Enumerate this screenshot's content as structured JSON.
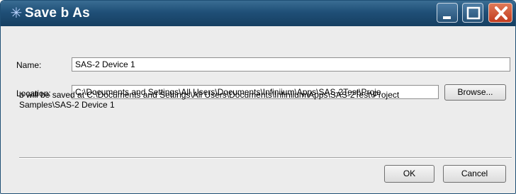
{
  "window": {
    "title": "Save b As",
    "app_icon": "agilent-spark-icon",
    "controls": {
      "minimize_icon": "minimize-icon",
      "maximize_icon": "maximize-icon",
      "close_icon": "close-icon"
    }
  },
  "form": {
    "name_label": "Name:",
    "name_value": "SAS-2 Device 1",
    "location_label": "Location:",
    "location_value": "C:\\Documents and Settings\\All Users\\Documents\\Infiniium\\Apps\\SAS-2Test\\Proje",
    "browse_label": "Browse..."
  },
  "info": {
    "line1": "b will be saved at C:\\Documents and Settings\\All Users\\Documents\\Infiniium\\Apps\\SAS-2Test\\Project",
    "line2": "Samples\\SAS-2 Device 1"
  },
  "buttons": {
    "ok_label": "OK",
    "cancel_label": "Cancel"
  },
  "colors": {
    "titlebar": "#1f4f77",
    "close_button": "#c23b1e",
    "dialog_background": "#ececec"
  }
}
